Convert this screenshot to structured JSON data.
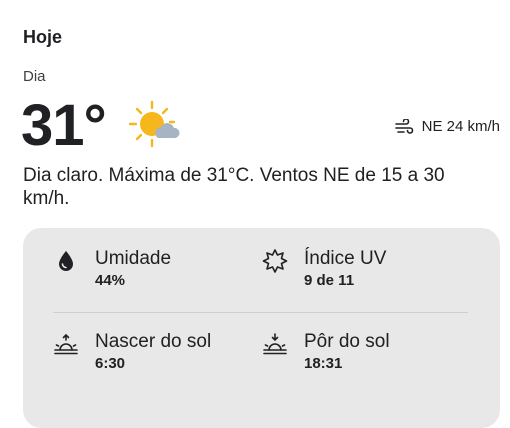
{
  "header": {
    "title": "Hoje",
    "period": "Dia"
  },
  "current": {
    "temperature": "31°",
    "condition_icon": "sun-with-cloud-icon",
    "wind": "NE 24 km/h",
    "description": "Dia claro. Máxima de 31°C. Ventos NE de 15 a 30 km/h."
  },
  "details": {
    "humidity": {
      "label": "Umidade",
      "value": "44%",
      "icon": "droplet-icon"
    },
    "uv": {
      "label": "Índice UV",
      "value": "9 de 11",
      "icon": "uv-sun-icon"
    },
    "sunrise": {
      "label": "Nascer do sol",
      "value": "6:30",
      "icon": "sunrise-icon"
    },
    "sunset": {
      "label": "Pôr do sol",
      "value": "18:31",
      "icon": "sunset-icon"
    }
  },
  "colors": {
    "sun": "#f6b71d",
    "cloud": "#a7b4c2",
    "card_bg": "#e8e8e8",
    "text": "#202124"
  }
}
